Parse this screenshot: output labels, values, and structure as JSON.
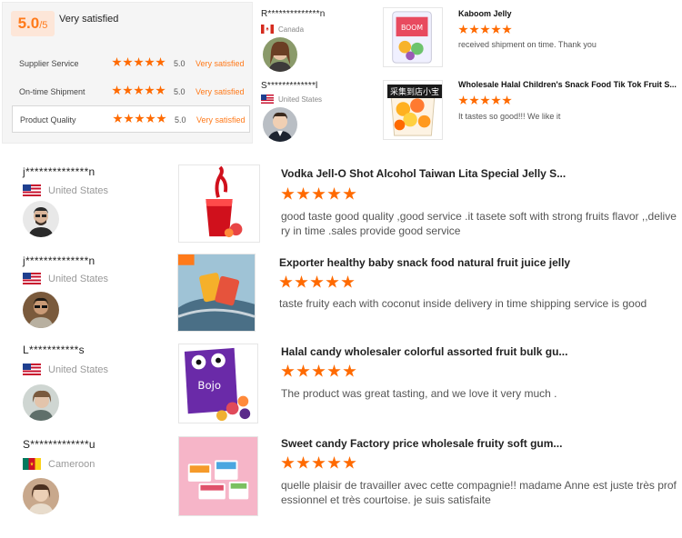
{
  "summary": {
    "score": "5.0",
    "score_out_of": "/5",
    "label": "Very satisfied",
    "metrics": [
      {
        "label": "Supplier Service",
        "score": "5.0",
        "text": "Very satisfied",
        "rating": 5
      },
      {
        "label": "On-time Shipment",
        "score": "5.0",
        "text": "Very satisfied",
        "rating": 5
      },
      {
        "label": "Product Quality",
        "score": "5.0",
        "text": "Very satisfied",
        "rating": 5
      }
    ]
  },
  "top_reviews": [
    {
      "name": "R**************n",
      "country": "Canada",
      "flag": "ca",
      "title": "Kaboom Jelly",
      "rating": 5,
      "comment": "received shipment on time. Thank you"
    },
    {
      "name": "S*************l",
      "country": "United States",
      "flag": "us",
      "title": "Wholesale Halal Children's Snack Food Tik Tok Fruit S...",
      "rating": 5,
      "comment": "It tastes so good!!! We like it",
      "image_caption": "采集到店小宝"
    }
  ],
  "reviews": [
    {
      "name": "j**************n",
      "country": "United States",
      "flag": "us",
      "title": "Vodka Jell-O Shot Alcohol Taiwan Lita Special Jelly S...",
      "rating": 5,
      "comment": "good taste good quality ,good service .it tasete soft with strong fruits flavor ,,delivery in time .sales provide good service"
    },
    {
      "name": "j**************n",
      "country": "United States",
      "flag": "us",
      "title": "Exporter healthy baby snack food natural fruit juice jelly",
      "rating": 5,
      "comment": "taste fruity each with coconut inside delivery in time shipping service is good"
    },
    {
      "name": "L***********s",
      "country": "United States",
      "flag": "us",
      "title": "Halal candy wholesaler colorful assorted fruit bulk gu...",
      "rating": 5,
      "comment": "The product was great tasting, and we love it very much ."
    },
    {
      "name": "S*************u",
      "country": "Cameroon",
      "flag": "cm",
      "title": "Sweet candy Factory price wholesale fruity soft gum...",
      "rating": 5,
      "comment": "quelle plaisir de travailler avec cette compagnie!! madame Anne est juste très professionnel et très courtoise. je suis satisfaite"
    }
  ],
  "colors": {
    "accent": "#ff6a00",
    "score_bg": "#fde6d8",
    "summary_bg": "#f5f5f5"
  }
}
